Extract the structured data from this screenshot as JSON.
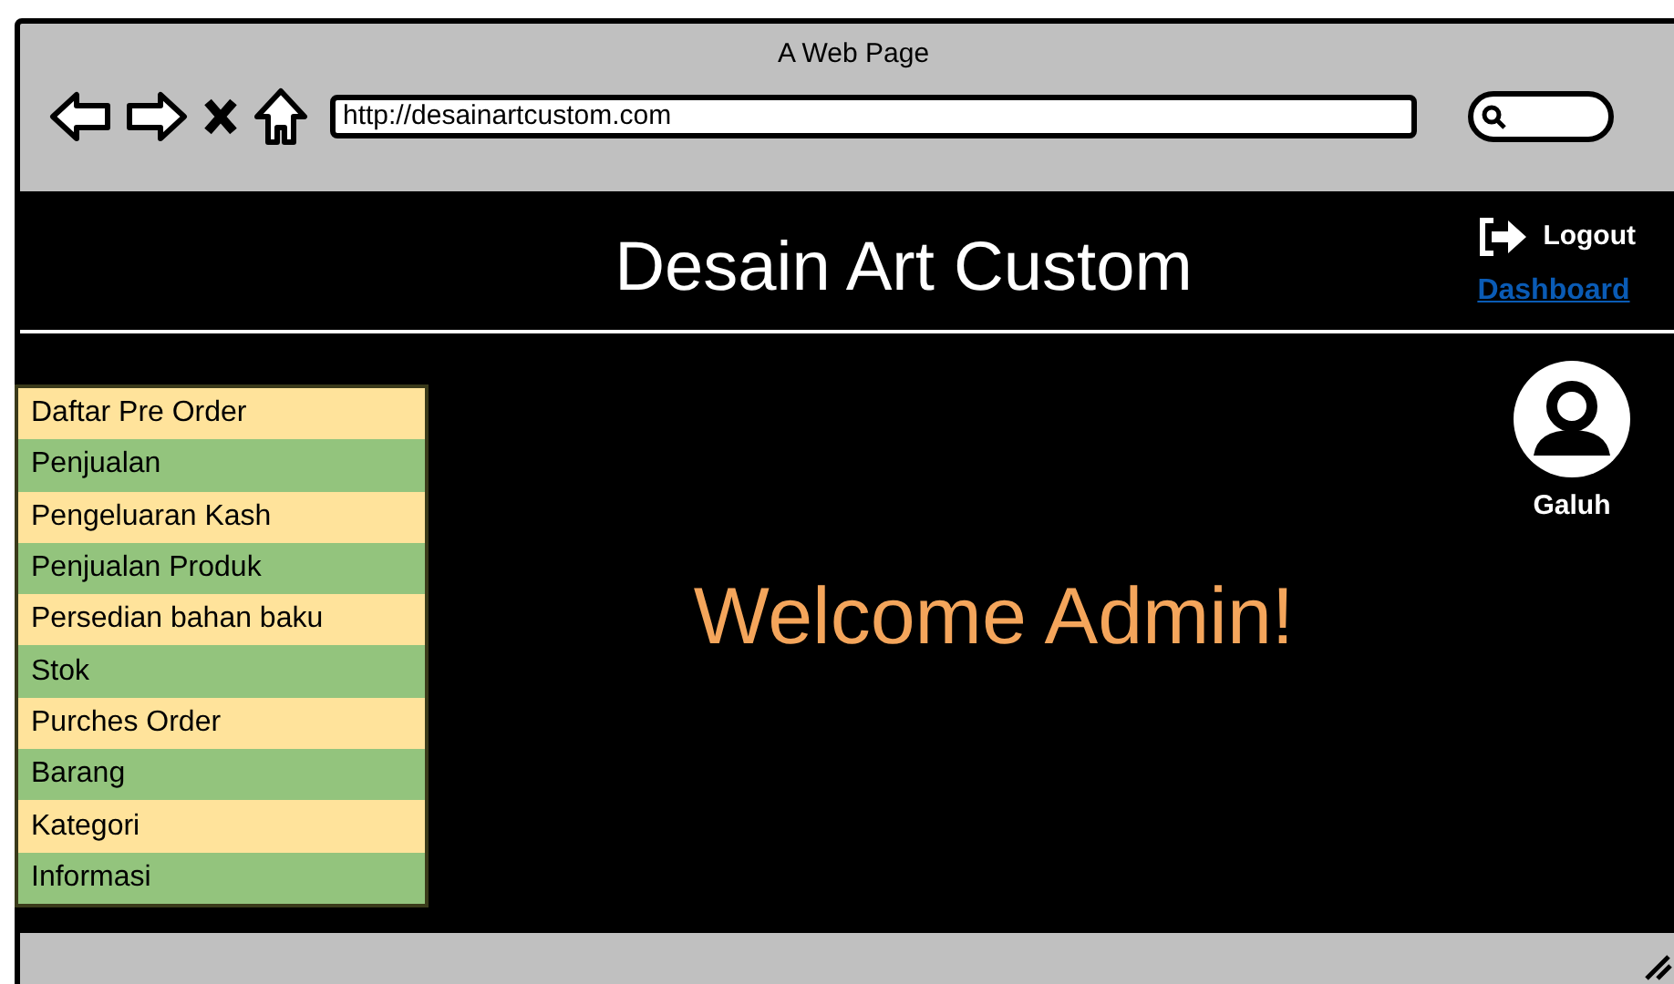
{
  "browser": {
    "title": "A Web Page",
    "url": "http://desainartcustom.com"
  },
  "header": {
    "title": "Desain Art Custom",
    "logout": "Logout",
    "dashboard_link": "Dashboard"
  },
  "user": {
    "name": "Galuh"
  },
  "menu": [
    {
      "label": "Daftar Pre Order",
      "color": "#ffe39b"
    },
    {
      "label": "Penjualan",
      "color": "#93c47d"
    },
    {
      "label": "Pengeluaran Kash",
      "color": "#ffe39b"
    },
    {
      "label": "Penjualan Produk",
      "color": "#93c47d"
    },
    {
      "label": "Persedian bahan baku",
      "color": "#ffe39b"
    },
    {
      "label": "Stok",
      "color": "#93c47d"
    },
    {
      "label": "Purches Order",
      "color": "#ffe39b"
    },
    {
      "label": "Barang",
      "color": "#93c47d"
    },
    {
      "label": "Kategori",
      "color": "#ffe39b"
    },
    {
      "label": "Informasi",
      "color": "#93c47d"
    }
  ],
  "welcome": "Welcome Admin!"
}
